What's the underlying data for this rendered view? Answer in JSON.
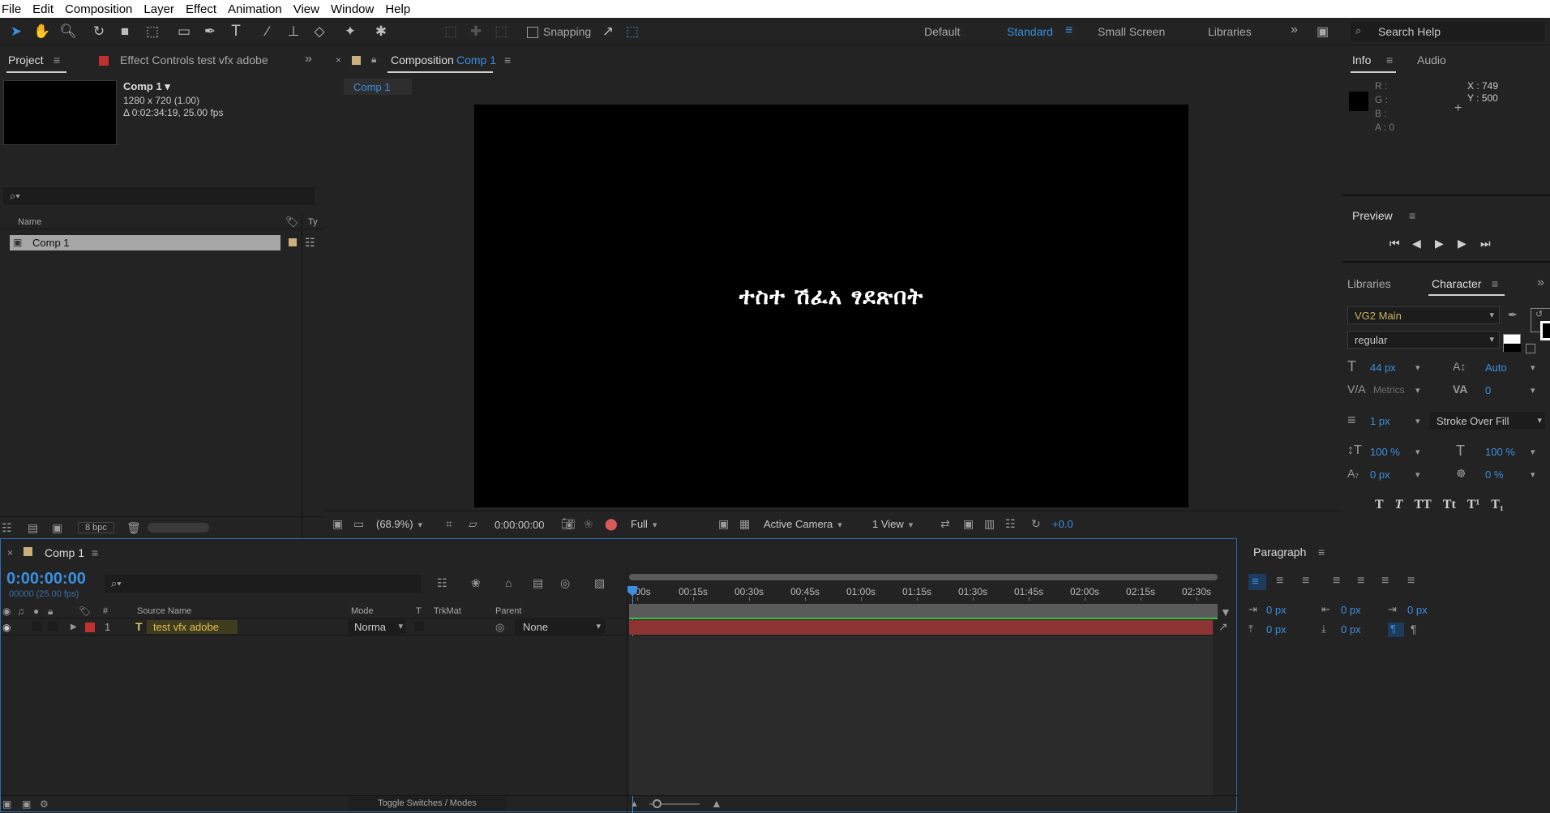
{
  "menu": [
    "File",
    "Edit",
    "Composition",
    "Layer",
    "Effect",
    "Animation",
    "View",
    "Window",
    "Help"
  ],
  "toolbar": {
    "snapping_label": "Snapping",
    "workspaces": [
      "Default",
      "Standard",
      "Small Screen",
      "Libraries"
    ],
    "search_placeholder": "Search Help"
  },
  "project": {
    "tab_project": "Project",
    "tab_effect_controls": "Effect Controls test vfx adobe",
    "comp_name": "Comp 1 ▾",
    "comp_size": "1280 x 720 (1.00)",
    "comp_duration": "Δ 0:02:34:19, 25.00 fps",
    "col_name": "Name",
    "col_type": "Ty",
    "item_name": "Comp 1",
    "bpc": "8 bpc"
  },
  "composition": {
    "tab_prefix": "Composition",
    "tab_comp": "Comp 1",
    "flow_tab": "Comp 1",
    "canvas_text": "ተስተ ሽፈአ ፃደጽበት",
    "zoom": "(68.9%)",
    "timecode": "0:00:00:00",
    "resolution": "Full",
    "camera": "Active Camera",
    "views": "1 View",
    "exposure": "+0.0"
  },
  "info": {
    "tab_info": "Info",
    "tab_audio": "Audio",
    "r": "R :",
    "g": "G :",
    "b": "B :",
    "a": "A : 0",
    "x": "X : 749",
    "y": "Y : 500"
  },
  "preview": {
    "title": "Preview"
  },
  "character": {
    "tab_libraries": "Libraries",
    "tab_character": "Character",
    "font": "VG2 Main",
    "style": "regular",
    "size": "44 px",
    "leading": "Auto",
    "kerning": "Metrics",
    "tracking": "0",
    "stroke_width": "1 px",
    "stroke_mode": "Stroke Over Fill",
    "vscale": "100 %",
    "hscale": "100 %",
    "baseline": "0 px",
    "tsume": "0 %",
    "styles": [
      "T",
      "T",
      "TT",
      "Tt",
      "T¹",
      "T₁"
    ],
    "colors": {
      "fill": "#ffffff",
      "stroke": "#000000"
    }
  },
  "timeline": {
    "comp_tab": "Comp 1",
    "timecode": "0:00:00:00",
    "frames": "00000 (25.00 fps)",
    "col_num": "#",
    "col_source": "Source Name",
    "col_mode": "Mode",
    "col_t": "T",
    "col_trkmat": "TrkMat",
    "col_parent": "Parent",
    "ticks": [
      ":00s",
      "00:15s",
      "00:30s",
      "00:45s",
      "01:00s",
      "01:15s",
      "01:30s",
      "01:45s",
      "02:00s",
      "02:15s",
      "02:30s"
    ],
    "layer": {
      "index": "1",
      "name": "test vfx adobe",
      "mode": "Norma",
      "parent": "None",
      "color": "#b93838"
    },
    "toggle_label": "Toggle Switches / Modes"
  },
  "paragraph": {
    "title": "Paragraph",
    "indent_left": "0 px",
    "indent_right": "0 px",
    "indent_first": "0 px",
    "space_before": "0 px",
    "space_after": "0 px"
  }
}
